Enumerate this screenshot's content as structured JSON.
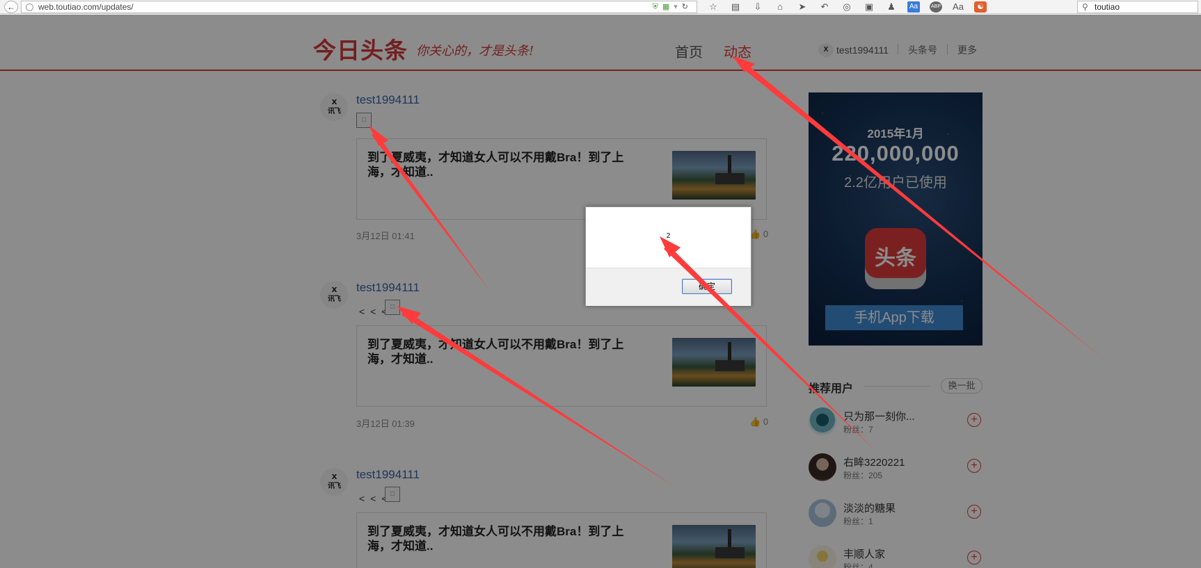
{
  "browser": {
    "url": "web.toutiao.com/updates/",
    "search_value": "toutiao",
    "toolbar_icons": [
      "star-icon",
      "reading-list-icon",
      "download-icon",
      "home-icon",
      "send-icon",
      "undo-icon",
      "screenshot-icon",
      "crop-icon",
      "person-icon",
      "translate-icon",
      "adblock-icon",
      "reader-icon",
      "addon-icon"
    ]
  },
  "header": {
    "logo": "今日头条",
    "slogan": "你关心的，才是头条!",
    "nav": [
      {
        "label": "首页",
        "active": false
      },
      {
        "label": "动态",
        "active": true
      }
    ],
    "user": "test1994111",
    "links": [
      "头条号",
      "更多"
    ],
    "accent": "#e03b3b"
  },
  "feed": [
    {
      "username": "test1994111",
      "prefix": "",
      "title": "到了夏威夷，才知道女人可以不用戴Bra！到了上海，才知道..",
      "time": "3月12日 01:41",
      "likes": "0"
    },
    {
      "username": "test1994111",
      "prefix": "< < <",
      "title": "到了夏威夷，才知道女人可以不用戴Bra！到了上海，才知道..",
      "time": "3月12日 01:39",
      "likes": "0"
    },
    {
      "username": "test1994111",
      "prefix": "< < <",
      "title": "到了夏威夷，才知道女人可以不用戴Bra！到了上海，才知道..",
      "time": "",
      "likes": ""
    }
  ],
  "avatar_text": "讯飞 iFLYTEK",
  "ad": {
    "date": "2015年1月",
    "count": "220,000,000",
    "users": "2.2亿用户已使用",
    "app_icon": "头条",
    "download": "手机App下载"
  },
  "recommend": {
    "title": "推荐用户",
    "refresh": "换一批",
    "users": [
      {
        "name": "只为那一刻你...",
        "fans": "粉丝：7"
      },
      {
        "name": "右眸3220221",
        "fans": "粉丝：205"
      },
      {
        "name": "淡淡的糖果",
        "fans": "粉丝：1"
      },
      {
        "name": "丰顺人家",
        "fans": "粉丝：4"
      }
    ]
  },
  "dialog": {
    "message": "2",
    "ok": "确定"
  },
  "colors": {
    "accent": "#e03b3b",
    "link": "#3a63a8",
    "arrow": "#ff3b3b"
  }
}
